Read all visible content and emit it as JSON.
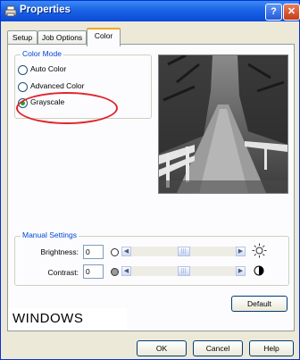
{
  "window": {
    "title": "Properties",
    "help_label": "?",
    "close_label": "✕"
  },
  "tabs": [
    {
      "label": "Setup",
      "active": false
    },
    {
      "label": "Job Options",
      "active": false
    },
    {
      "label": "Color",
      "active": true
    }
  ],
  "color_mode": {
    "label": "Color Mode",
    "options": [
      {
        "label": "Auto Color",
        "checked": false
      },
      {
        "label": "Advanced Color",
        "checked": false
      },
      {
        "label": "Grayscale",
        "checked": true
      }
    ]
  },
  "manual_settings": {
    "label": "Manual Settings",
    "brightness": {
      "label": "Brightness:",
      "value": "0",
      "level": 0.5
    },
    "contrast": {
      "label": "Contrast:",
      "value": "0",
      "level": 0.5
    }
  },
  "buttons": {
    "default": "Default",
    "ok": "OK",
    "cancel": "Cancel",
    "help": "Help"
  },
  "watermark": "WINDOWS",
  "icons": {
    "sun": "sun-icon",
    "contrast": "contrast-icon"
  }
}
